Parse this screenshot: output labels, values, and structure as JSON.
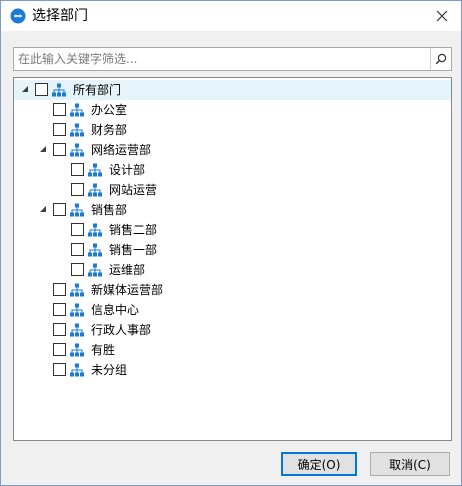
{
  "window": {
    "title": "选择部门",
    "close_glyph": "✕",
    "app_icon": "app-logo-icon",
    "accent_color": "#1a7bd6"
  },
  "search": {
    "value": "",
    "placeholder": "在此输入关键字筛选...",
    "icon": "search-icon"
  },
  "tree": {
    "node_icon": "org-chart-icon",
    "nodes": [
      {
        "label": "所有部门",
        "level": 0,
        "expanded": true,
        "has_children": true,
        "checked": false,
        "selected": true
      },
      {
        "label": "办公室",
        "level": 1,
        "expanded": false,
        "has_children": false,
        "checked": false,
        "selected": false
      },
      {
        "label": "财务部",
        "level": 1,
        "expanded": false,
        "has_children": false,
        "checked": false,
        "selected": false
      },
      {
        "label": "网络运营部",
        "level": 1,
        "expanded": true,
        "has_children": true,
        "checked": false,
        "selected": false
      },
      {
        "label": "设计部",
        "level": 2,
        "expanded": false,
        "has_children": false,
        "checked": false,
        "selected": false
      },
      {
        "label": "网站运营",
        "level": 2,
        "expanded": false,
        "has_children": false,
        "checked": false,
        "selected": false
      },
      {
        "label": "销售部",
        "level": 1,
        "expanded": true,
        "has_children": true,
        "checked": false,
        "selected": false
      },
      {
        "label": "销售二部",
        "level": 2,
        "expanded": false,
        "has_children": false,
        "checked": false,
        "selected": false
      },
      {
        "label": "销售一部",
        "level": 2,
        "expanded": false,
        "has_children": false,
        "checked": false,
        "selected": false
      },
      {
        "label": "运维部",
        "level": 2,
        "expanded": false,
        "has_children": false,
        "checked": false,
        "selected": false
      },
      {
        "label": "新媒体运营部",
        "level": 1,
        "expanded": false,
        "has_children": false,
        "checked": false,
        "selected": false
      },
      {
        "label": "信息中心",
        "level": 1,
        "expanded": false,
        "has_children": false,
        "checked": false,
        "selected": false
      },
      {
        "label": "行政人事部",
        "level": 1,
        "expanded": false,
        "has_children": false,
        "checked": false,
        "selected": false
      },
      {
        "label": "有胜",
        "level": 1,
        "expanded": false,
        "has_children": false,
        "checked": false,
        "selected": false
      },
      {
        "label": "未分组",
        "level": 1,
        "expanded": false,
        "has_children": false,
        "checked": false,
        "selected": false
      }
    ]
  },
  "buttons": {
    "ok_label": "确定(O)",
    "cancel_label": "取消(C)"
  }
}
